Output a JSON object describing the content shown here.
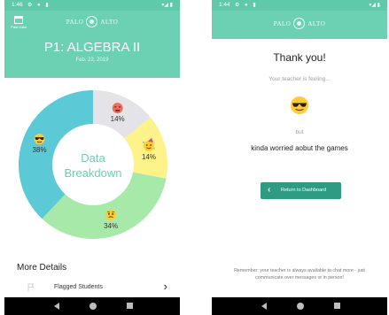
{
  "left_screen": {
    "status": {
      "time": "1:46",
      "icons": "⚙ ● ▮",
      "right_icons": "▾◢ ▮"
    },
    "logo": {
      "left": "PALO",
      "right": "ALTO"
    },
    "calendar_label": "Past Data",
    "class_title": "P1: ALGEBRA II",
    "date": "Feb. 22, 2019",
    "center_text_line1": "Data",
    "center_text_line2": "Breakdown",
    "more_details_title": "More Details",
    "flagged_label": "Flagged Students",
    "chevron": "›"
  },
  "chart_data": {
    "type": "pie",
    "title": "",
    "slices": [
      {
        "label": "14%",
        "value": 14,
        "color": "#e3e3e8",
        "icon": "frustrated-emoji"
      },
      {
        "label": "14%",
        "value": 14,
        "color": "#fdf38a",
        "icon": "partying-emoji"
      },
      {
        "label": "34%",
        "value": 34,
        "color": "#a7e9a8",
        "icon": "worried-emoji"
      },
      {
        "label": "38%",
        "value": 38,
        "color": "#5cc9d6",
        "icon": "cool-sunglasses-emoji"
      }
    ]
  },
  "right_screen": {
    "status": {
      "time": "1:44",
      "icons": "⚙ ● ▮",
      "right_icons": "▾◢ ▮"
    },
    "logo": {
      "left": "PALO",
      "right": "ALTO"
    },
    "thank_you": "Thank you!",
    "feeling_text": "Your teacher is feeling...",
    "feeling_icon": "cool-sunglasses-emoji",
    "but_text": "but",
    "worry_text": "kinda worried aobut the games",
    "return_button": "Return to Dashboard",
    "footer_note": "Remember: your teacher is always available to chat more - just communicate over messages or in person!"
  },
  "colors": {
    "header": "#6cd0b2",
    "statusbar": "#5fc9aa",
    "button": "#2f9b82",
    "accent_text": "#6cd0b2"
  }
}
